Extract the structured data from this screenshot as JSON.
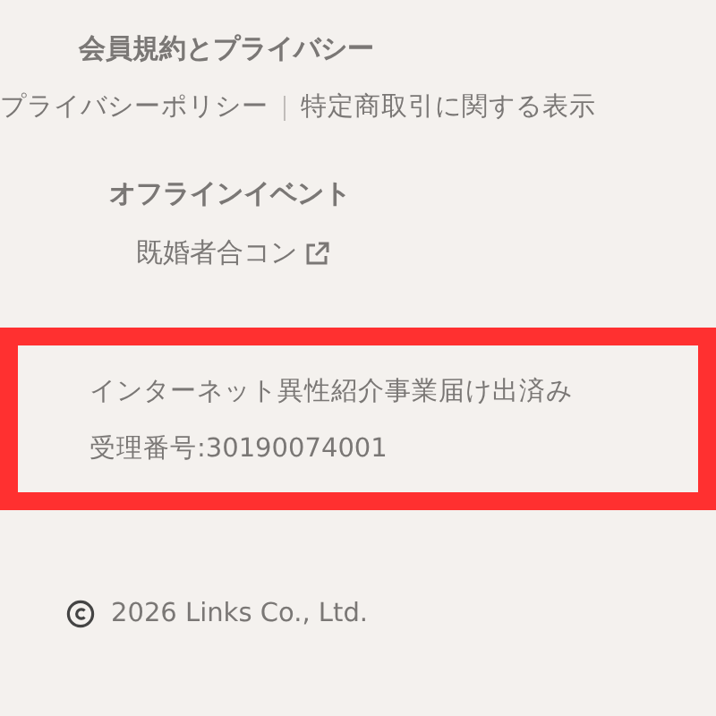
{
  "terms": {
    "heading": "会員規約とプライバシー",
    "links": [
      "プライバシーポリシー",
      "特定商取引に関する表示"
    ],
    "separator": "｜"
  },
  "events": {
    "heading": "オフラインイベント",
    "link": "既婚者合コン"
  },
  "notice": {
    "highlighted": true,
    "lines": [
      "インターネット異性紹介事業届け出済み",
      "受理番号:30190074001"
    ]
  },
  "footer": {
    "copyright": "2026 Links Co., Ltd."
  }
}
